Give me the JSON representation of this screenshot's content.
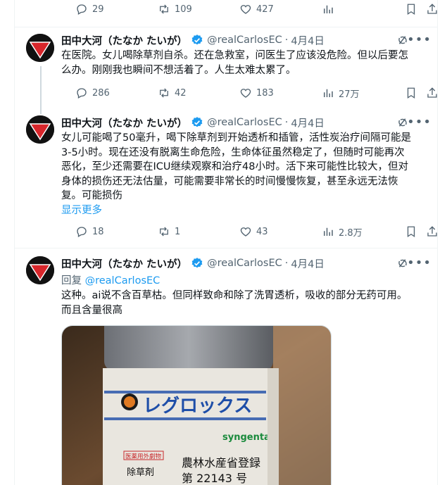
{
  "top_actions": {
    "replies": "29",
    "retweets": "109",
    "likes": "427"
  },
  "author": {
    "name": "田中大河（たなか たいが）",
    "handle": "@realCarlosEC",
    "dot": "·",
    "date": "4月4日",
    "avatar_text": "止まれ",
    "avatar_sub": "STOP"
  },
  "tweets": [
    {
      "text": "在医院。女儿喝除草剂自杀。还在急救室，问医生了应该没危险。但以后要怎么办。刚刚我也瞬间不想活着了。人生太难太累了。",
      "lines": [
        "在医院。女儿喝除草剂自杀。还在急救室，问医生了应该没危险。但以后要怎",
        "么办。刚刚我也瞬间不想活着了。人生太难太累了。"
      ],
      "replies": "286",
      "retweets": "42",
      "likes": "183",
      "views": "27万"
    },
    {
      "lines": [
        "女儿可能喝了50毫升，喝下除草剂到开始透析和插管，活性炭治疗间隔可能是",
        "3-5小时。现在还没有脱离生命危险，生命体征虽然稳定了，但随时可能再次",
        "恶化，至少还需要在ICU继续观察和治疗48小时。活下来可能性比较大，但对",
        "身体的损伤还无法估量，可能需要非常长的时间慢慢恢复，甚至永远无法恢",
        "复。可能损伤"
      ],
      "show_more": "显示更多",
      "replies": "18",
      "retweets": "1",
      "likes": "43",
      "views": "2.8万"
    },
    {
      "reply_prefix": "回复",
      "reply_to": "@realCarlosEC",
      "lines": [
        "这种。ai说不含百草枯。但同样致命和除了洗胃透析，吸收的部分无药可用。",
        "而且含量很高"
      ],
      "image": {
        "brand_jp": "レグロックス",
        "maker": "syngenta",
        "reg_line1": "農林水産省登録",
        "reg_line2": "第 22143 号",
        "label_small": "医薬用外劇物",
        "label_type": "除草剤"
      }
    }
  ],
  "colors": {
    "accent": "#1d9bf0",
    "muted": "#536471",
    "verified": "#1d9bf0"
  }
}
